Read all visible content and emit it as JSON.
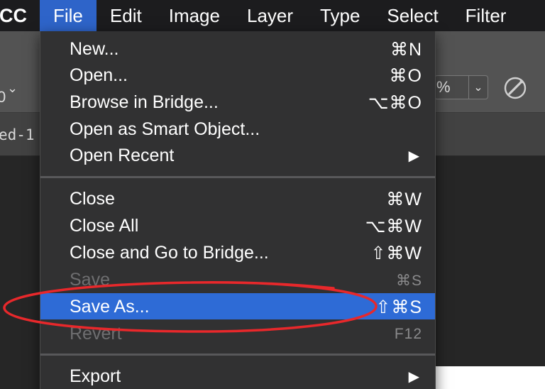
{
  "menubar": {
    "app": "CC",
    "items": [
      "File",
      "Edit",
      "Image",
      "Layer",
      "Type",
      "Select",
      "Filter"
    ],
    "active_index": 0
  },
  "background": {
    "document_tab": "ed-1",
    "zero_label": "0",
    "percent_label": "%"
  },
  "file_menu": {
    "items": [
      {
        "label": "New...",
        "shortcut": "⌘N",
        "enabled": true
      },
      {
        "label": "Open...",
        "shortcut": "⌘O",
        "enabled": true
      },
      {
        "label": "Browse in Bridge...",
        "shortcut": "⌥⌘O",
        "enabled": true
      },
      {
        "label": "Open as Smart Object...",
        "shortcut": "",
        "enabled": true
      },
      {
        "label": "Open Recent",
        "shortcut": "",
        "submenu": true,
        "enabled": true
      },
      {
        "label": "Close",
        "shortcut": "⌘W",
        "enabled": true
      },
      {
        "label": "Close All",
        "shortcut": "⌥⌘W",
        "enabled": true
      },
      {
        "label": "Close and Go to Bridge...",
        "shortcut": "⇧⌘W",
        "enabled": true
      },
      {
        "label": "Save",
        "shortcut": "⌘S",
        "enabled": false
      },
      {
        "label": "Save As...",
        "shortcut": "⇧⌘S",
        "enabled": true,
        "selected": true
      },
      {
        "label": "Revert",
        "shortcut": "F12",
        "enabled": false
      },
      {
        "label": "Export",
        "shortcut": "",
        "submenu": true,
        "enabled": true
      }
    ]
  },
  "colors": {
    "menubar_active": "#2e64c9",
    "menu_bg": "#313132",
    "selected": "#2e6bd6",
    "annotation": "#e8282b"
  },
  "icons": {
    "submenu": "triangle-right-icon",
    "dropdown": "chevron-down-icon",
    "airbrush": "airbrush-icon"
  }
}
